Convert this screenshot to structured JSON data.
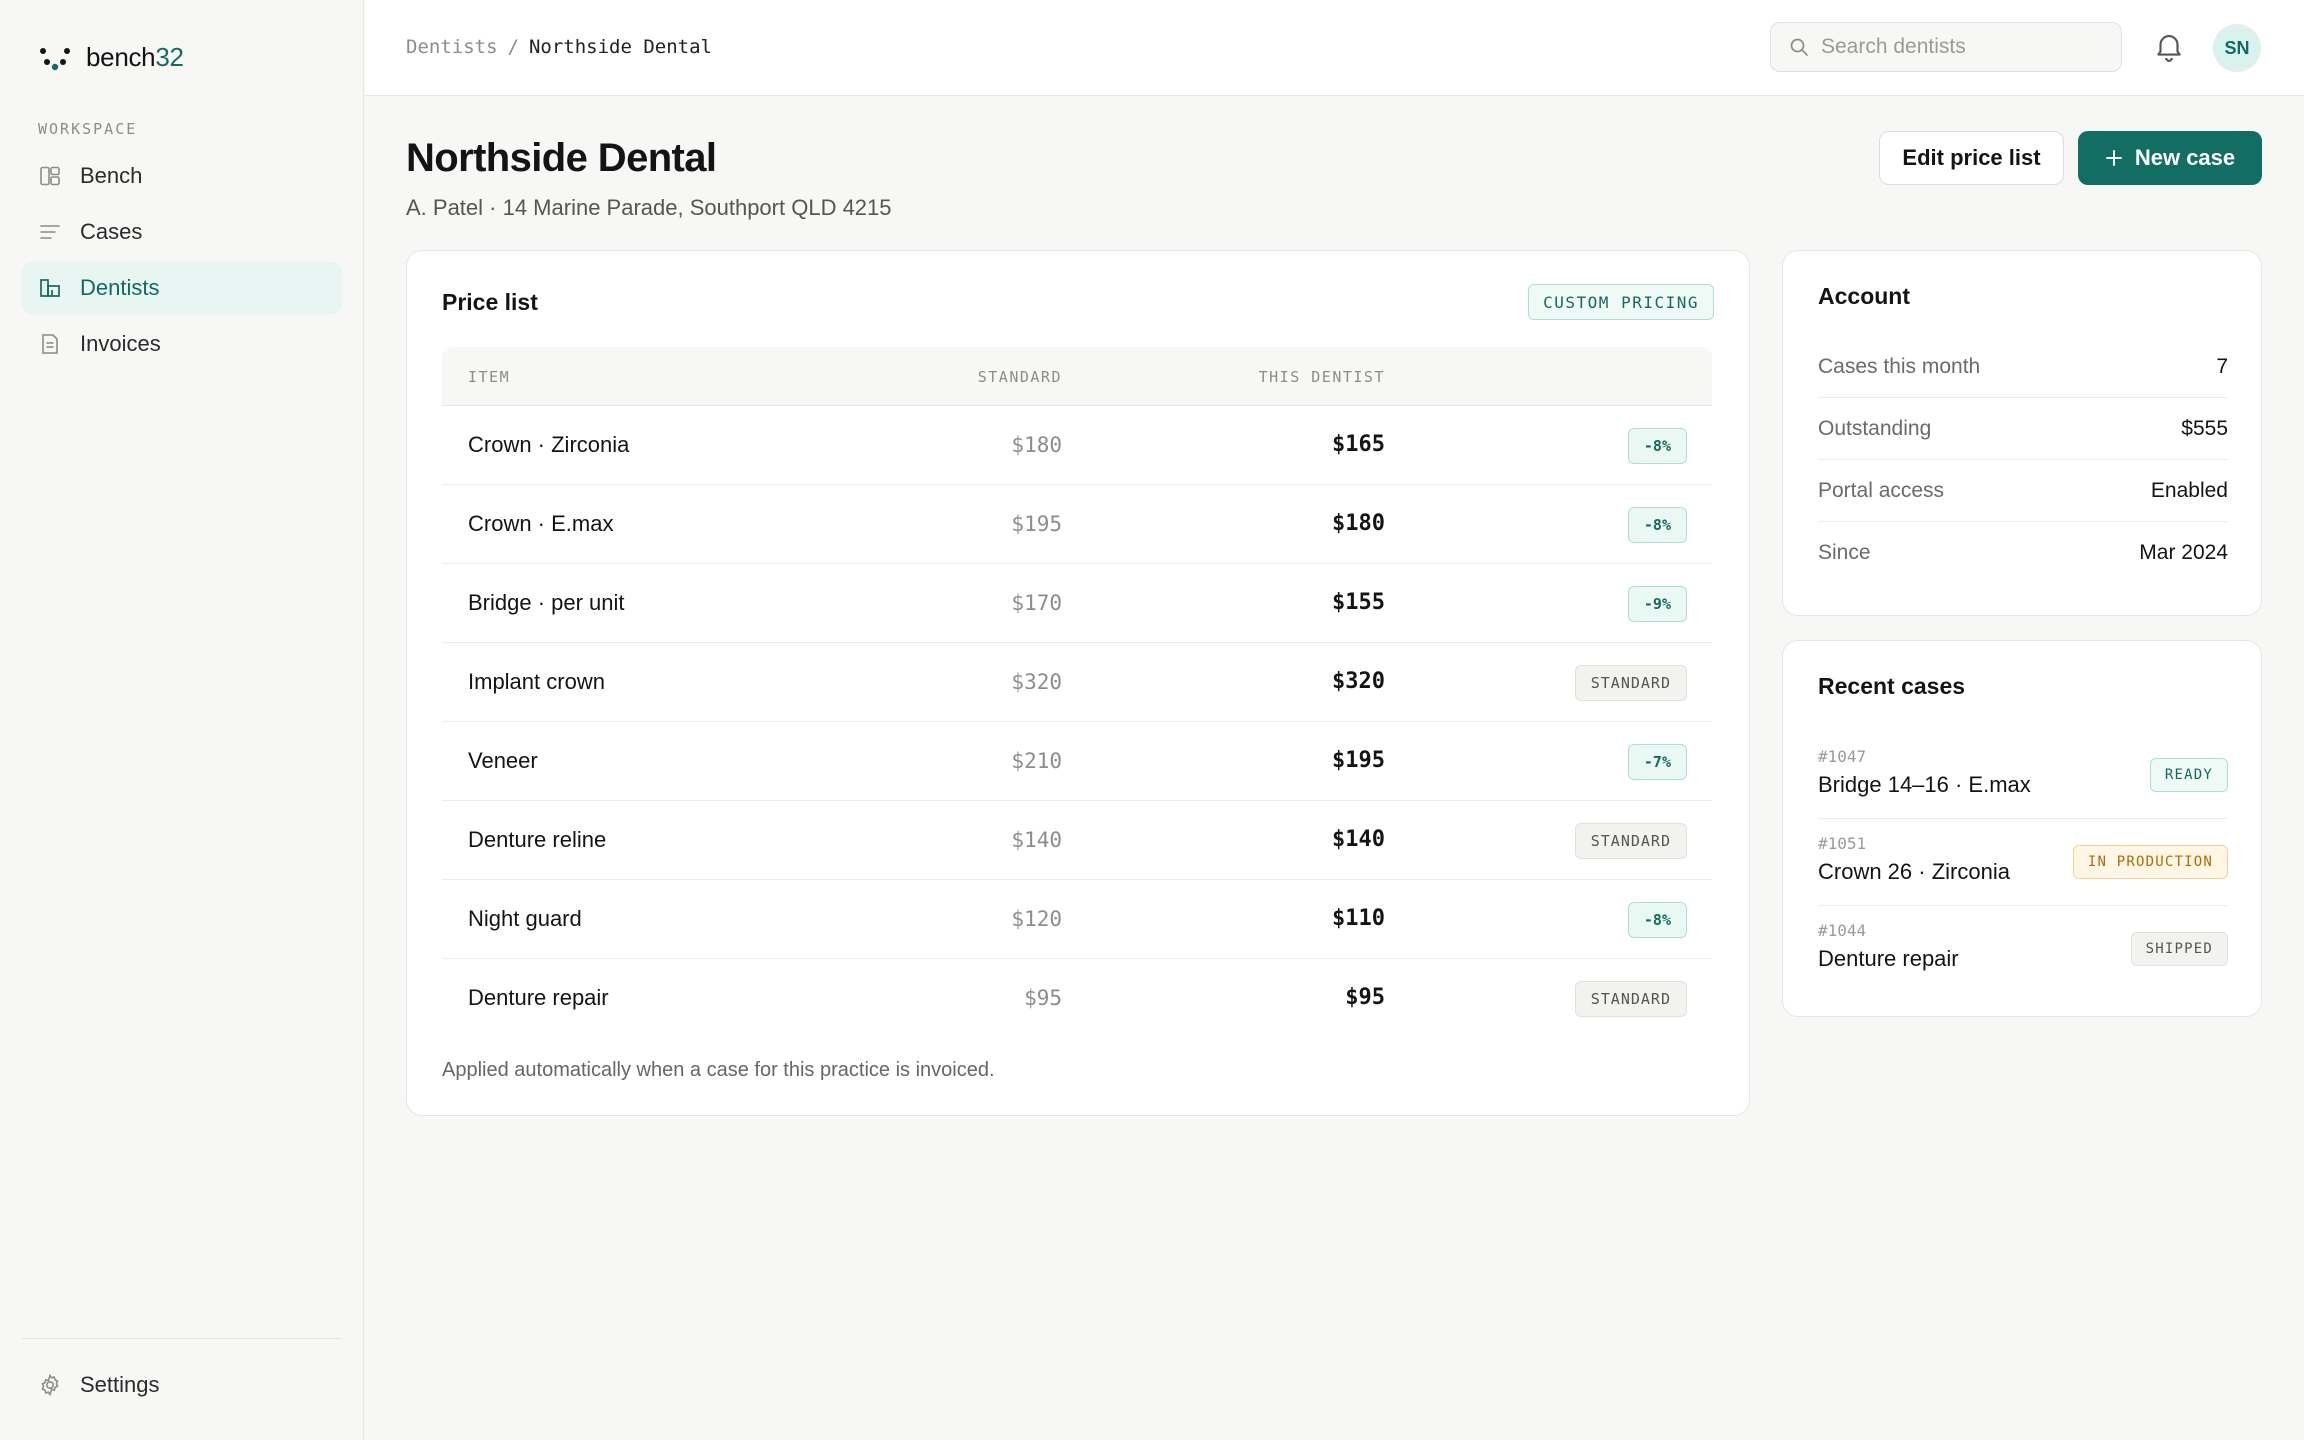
{
  "brand": {
    "name": "bench",
    "suffix": "32",
    "accent": "#126e62"
  },
  "sidebar": {
    "section_label": "WORKSPACE",
    "items": [
      {
        "label": "Bench",
        "icon": "layout-icon",
        "active": false
      },
      {
        "label": "Cases",
        "icon": "lines-icon",
        "active": false
      },
      {
        "label": "Dentists",
        "icon": "building-icon",
        "active": true
      },
      {
        "label": "Invoices",
        "icon": "document-icon",
        "active": false
      }
    ],
    "settings_label": "Settings"
  },
  "topbar": {
    "breadcrumb": {
      "parent": "Dentists",
      "separator": "/",
      "current": "Northside Dental"
    },
    "search_placeholder": "Search dentists",
    "avatar_initials": "SN"
  },
  "header": {
    "title": "Northside Dental",
    "subtitle": "A. Patel · 14 Marine Parade, Southport QLD 4215",
    "edit_button": "Edit price list",
    "new_button": "New case"
  },
  "price_list": {
    "title": "Price list",
    "badge": "CUSTOM PRICING",
    "columns": {
      "item": "ITEM",
      "standard": "STANDARD",
      "this_dentist": "THIS DENTIST"
    },
    "rows": [
      {
        "item": "Crown · Zirconia",
        "standard": "$180",
        "this": "$165",
        "badge": "-8%",
        "kind": "disc"
      },
      {
        "item": "Crown · E.max",
        "standard": "$195",
        "this": "$180",
        "badge": "-8%",
        "kind": "disc"
      },
      {
        "item": "Bridge · per unit",
        "standard": "$170",
        "this": "$155",
        "badge": "-9%",
        "kind": "disc"
      },
      {
        "item": "Implant crown",
        "standard": "$320",
        "this": "$320",
        "badge": "STANDARD",
        "kind": "std"
      },
      {
        "item": "Veneer",
        "standard": "$210",
        "this": "$195",
        "badge": "-7%",
        "kind": "disc"
      },
      {
        "item": "Denture reline",
        "standard": "$140",
        "this": "$140",
        "badge": "STANDARD",
        "kind": "std"
      },
      {
        "item": "Night guard",
        "standard": "$120",
        "this": "$110",
        "badge": "-8%",
        "kind": "disc"
      },
      {
        "item": "Denture repair",
        "standard": "$95",
        "this": "$95",
        "badge": "STANDARD",
        "kind": "std"
      }
    ],
    "note": "Applied automatically when a case for this practice is invoiced."
  },
  "account": {
    "title": "Account",
    "rows": [
      {
        "label": "Cases this month",
        "value": "7"
      },
      {
        "label": "Outstanding",
        "value": "$555"
      },
      {
        "label": "Portal access",
        "value": "Enabled"
      },
      {
        "label": "Since",
        "value": "Mar 2024"
      }
    ]
  },
  "recent_cases": {
    "title": "Recent cases",
    "items": [
      {
        "id": "#1047",
        "name": "Bridge 14–16 · E.max",
        "status": "READY",
        "kind": "ready"
      },
      {
        "id": "#1051",
        "name": "Crown 26 · Zirconia",
        "status": "IN PRODUCTION",
        "kind": "prod"
      },
      {
        "id": "#1044",
        "name": "Denture repair",
        "status": "SHIPPED",
        "kind": "ship"
      }
    ]
  }
}
